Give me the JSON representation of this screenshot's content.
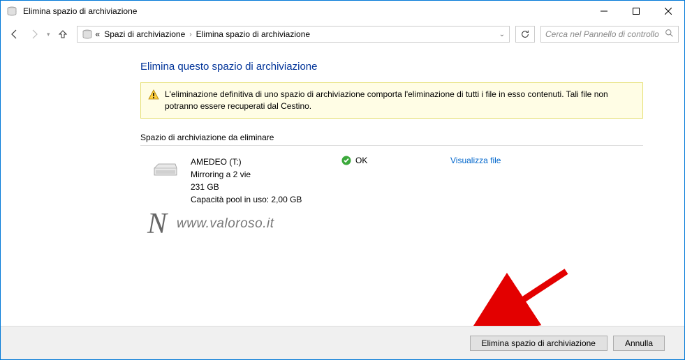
{
  "window": {
    "title": "Elimina spazio di archiviazione"
  },
  "breadcrumb": {
    "prefix": "«",
    "item1": "Spazi di archiviazione",
    "item2": "Elimina spazio di archiviazione"
  },
  "search": {
    "placeholder": "Cerca nel Pannello di controllo"
  },
  "page": {
    "heading": "Elimina questo spazio di archiviazione",
    "warning": "L'eliminazione definitiva di uno spazio di archiviazione comporta l'eliminazione di tutti i file in esso contenuti. Tali file non potranno essere recuperati dal Cestino.",
    "section_label": "Spazio di archiviazione da eliminare"
  },
  "drive": {
    "name": "AMEDEO (T:)",
    "mode": "Mirroring a 2 vie",
    "size": "231 GB",
    "pool_usage": "Capacità pool in uso: 2,00 GB",
    "status_text": "OK",
    "view_files": "Visualizza file"
  },
  "watermark": {
    "text": "www.valoroso.it"
  },
  "buttons": {
    "delete": "Elimina spazio di archiviazione",
    "cancel": "Annulla"
  }
}
